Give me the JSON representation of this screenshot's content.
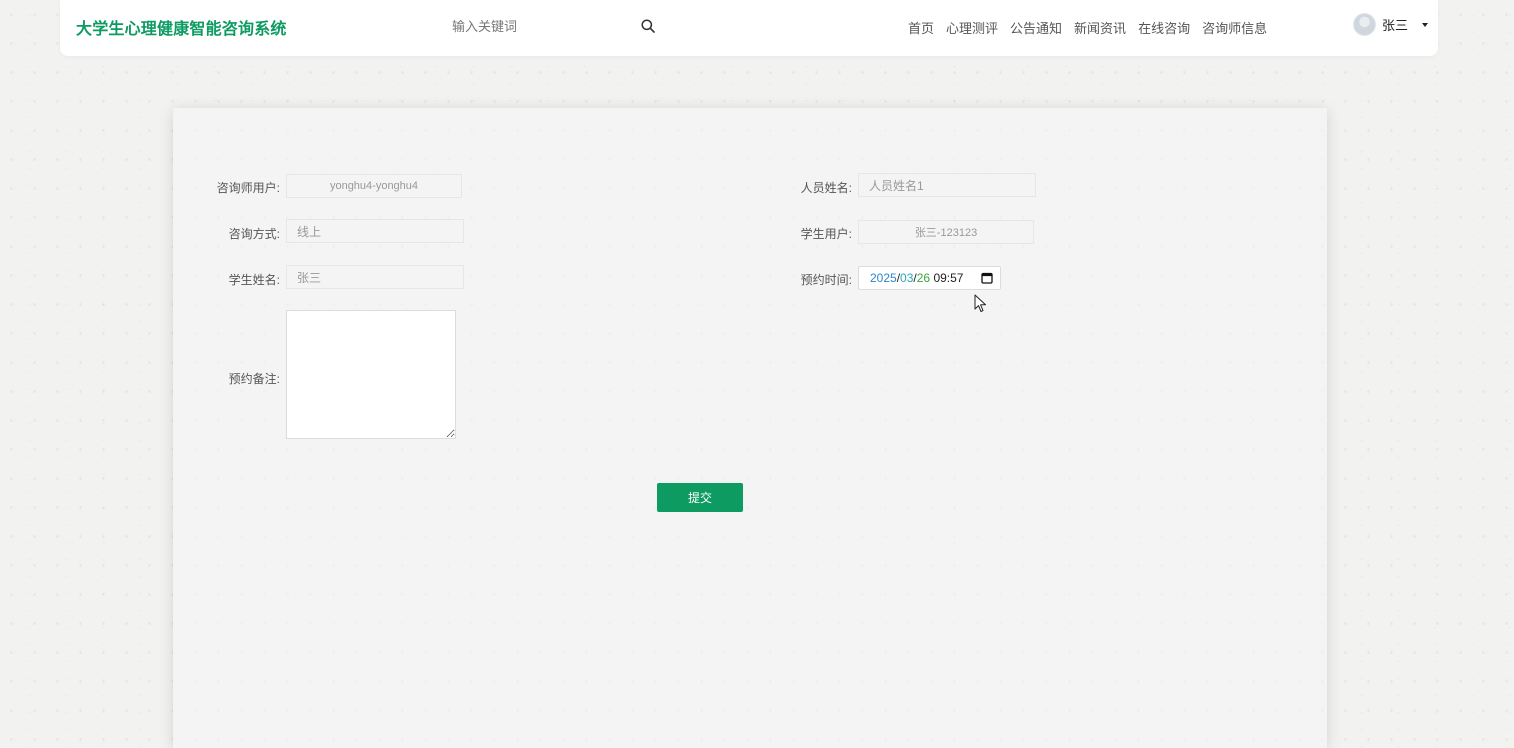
{
  "header": {
    "logo": "大学生心理健康智能咨询系统",
    "search_placeholder": "输入关键词",
    "nav": [
      "首页",
      "心理测评",
      "公告通知",
      "新闻资讯",
      "在线咨询",
      "咨询师信息"
    ],
    "user_name": "张三"
  },
  "form": {
    "counselor_user": {
      "label": "咨询师用户:",
      "value": "yonghu4-yonghu4"
    },
    "staff_name": {
      "label": "人员姓名:",
      "value": "人员姓名1"
    },
    "consult_method": {
      "label": "咨询方式:",
      "value": "线上"
    },
    "student_user": {
      "label": "学生用户:",
      "value": "张三-123123"
    },
    "student_name": {
      "label": "学生姓名:",
      "value": "张三"
    },
    "appointment_time": {
      "label": "预约时间:",
      "year": "2025",
      "month": "03",
      "day": "26",
      "sep": "/",
      "time": "09:57"
    },
    "remark": {
      "label": "预约备注:",
      "value": ""
    },
    "submit_label": "提交"
  }
}
